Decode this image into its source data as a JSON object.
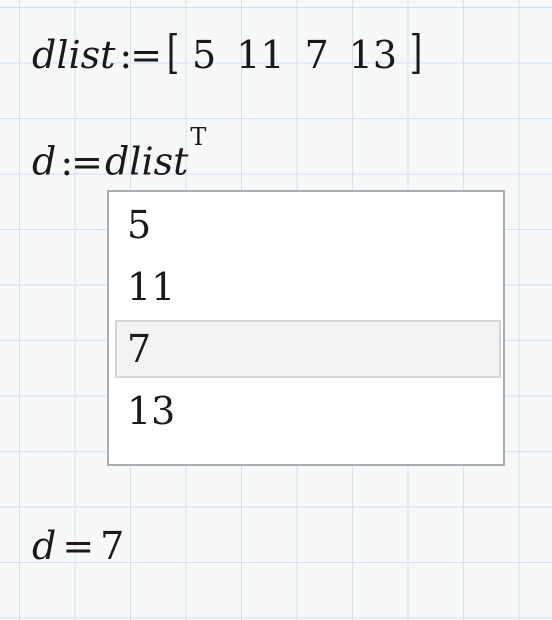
{
  "worksheet": {
    "row1": {
      "var": "dlist",
      "op": ":=",
      "open_bracket": "[",
      "values": [
        "5",
        "11",
        "7",
        "13"
      ],
      "close_bracket": "]"
    },
    "row2": {
      "var": "d",
      "op": ":=",
      "rhs": "dlist",
      "superscript": "T"
    },
    "dropdown": {
      "options": [
        "5",
        "11",
        "7",
        "13"
      ],
      "selected": "7"
    },
    "row3": {
      "var": "d",
      "op": "=",
      "result": "7"
    }
  }
}
